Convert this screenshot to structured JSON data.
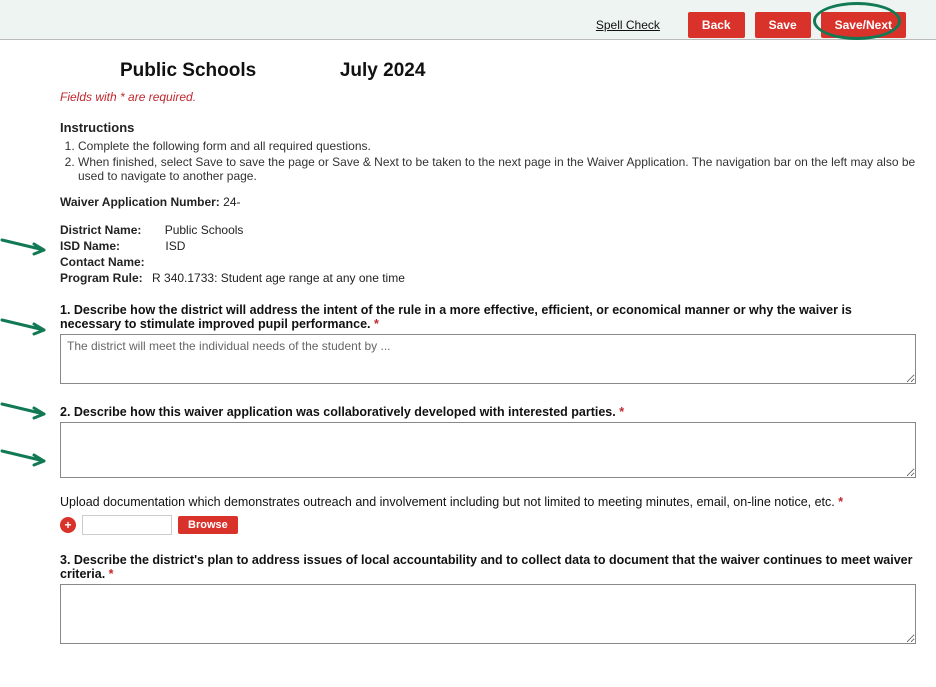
{
  "topbar": {
    "spell_check": "Spell Check",
    "back": "Back",
    "save": "Save",
    "save_next": "Save/Next"
  },
  "header": {
    "title_left": "Public Schools",
    "title_right": "July 2024"
  },
  "required_note": "Fields with * are required.",
  "instructions": {
    "heading": "Instructions",
    "items": [
      "Complete the following form and all required questions.",
      "When finished, select Save to save the page or Save & Next to be taken to the next page in the Waiver Application. The navigation bar on the left may also be used to navigate to another page."
    ],
    "save_word": "Save",
    "savenext_word": "Save & Next"
  },
  "meta": {
    "waiver_label": "Waiver Application Number:",
    "waiver_value": "24-",
    "district_label": "District Name:",
    "district_value": "Public Schools",
    "isd_label": "ISD Name:",
    "isd_value": "ISD",
    "contact_label": "Contact Name:",
    "contact_value": "",
    "program_label": "Program Rule:",
    "program_value": "R 340.1733: Student age range at any one time"
  },
  "q1": {
    "label": "1. Describe how the district will address the intent of the rule in a more effective, efficient, or economical manner or why the waiver is necessary to stimulate improved pupil performance.",
    "value": "The district will meet the individual needs of the student by ..."
  },
  "q2": {
    "label": "2. Describe how this waiver application was collaboratively developed with interested parties.",
    "value": ""
  },
  "upload": {
    "label": "Upload documentation which demonstrates outreach and involvement including but not limited to meeting minutes, email, on-line notice, etc.",
    "browse": "Browse"
  },
  "q3": {
    "label": "3. Describe the district's plan to address issues of local accountability and to collect data to document that the waiver continues to meet waiver criteria.",
    "value": ""
  }
}
